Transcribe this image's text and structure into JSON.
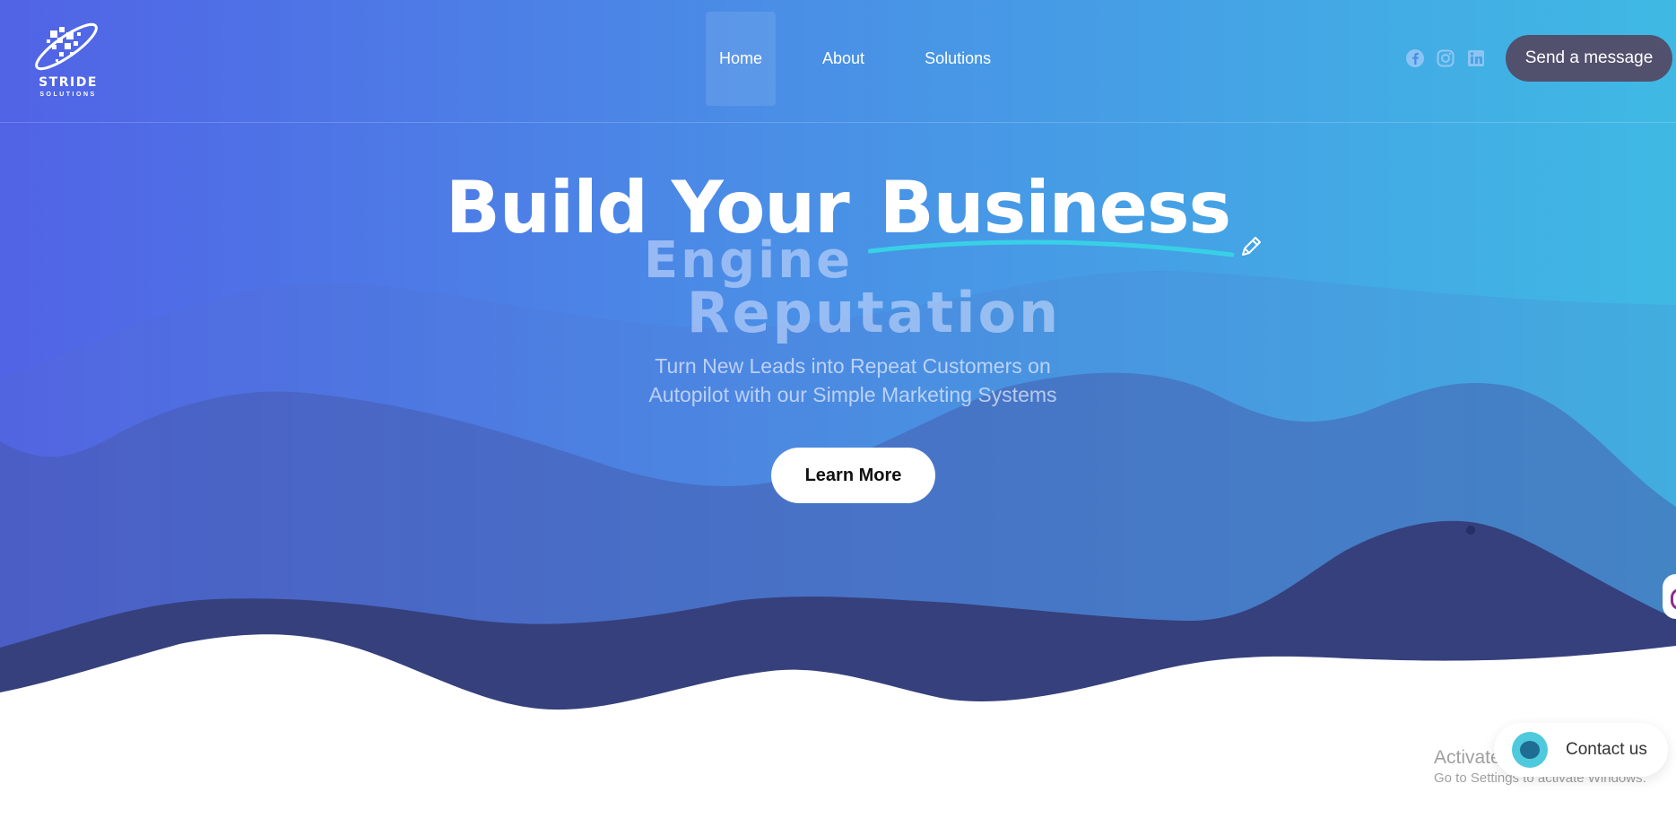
{
  "brand": {
    "name": "STRIDE",
    "tagline": "SOLUTIONS"
  },
  "nav": {
    "items": [
      {
        "label": "Home",
        "active": true
      },
      {
        "label": "About",
        "active": false
      },
      {
        "label": "Solutions",
        "active": false
      }
    ]
  },
  "socials": [
    "facebook-icon",
    "instagram-icon",
    "linkedin-icon"
  ],
  "header": {
    "cta_label": "Send a message"
  },
  "hero": {
    "headline_part1": "Build Your",
    "headline_part2": "Business",
    "rotating_word_1": "Engine",
    "rotating_word_2": "Reputation",
    "subheading_line1": "Turn New Leads into Repeat Customers on",
    "subheading_line2": "Autopilot with our Simple Marketing Systems",
    "button_label": "Learn More"
  },
  "contact_widget": {
    "label": "Contact us"
  },
  "os_watermark": {
    "line1": "Activate Windows",
    "line2": "Go to Settings to activate Windows."
  },
  "colors": {
    "gradient_start": "#5163e6",
    "gradient_end": "#3fb9e4",
    "cta_bg": "#51516e",
    "underline_accent": "#38d0e6",
    "wave_dark": "#36407c"
  }
}
